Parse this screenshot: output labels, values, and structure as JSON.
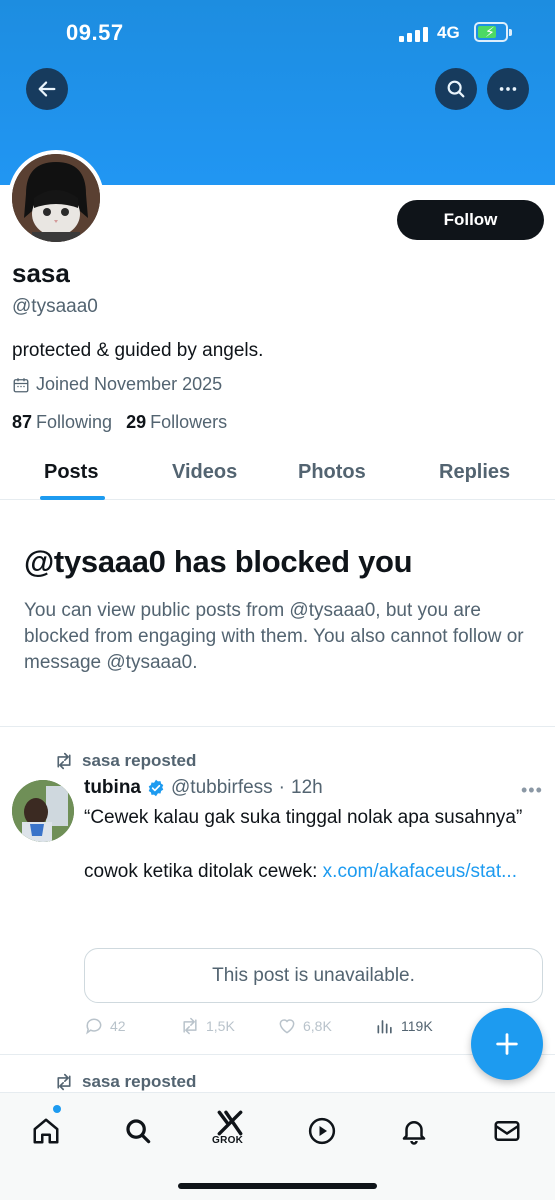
{
  "status_bar": {
    "time": "09.57",
    "network": "4G"
  },
  "header": {
    "back_icon": "arrow-left-icon",
    "search_icon": "search-icon",
    "more_icon": "more-horizontal-icon"
  },
  "profile": {
    "display_name": "sasa",
    "handle": "@tysaaa0",
    "follow_label": "Follow",
    "bio": "protected & guided by angels.",
    "joined": "Joined November 2025",
    "following_count": "87",
    "following_label": "Following",
    "followers_count": "29",
    "followers_label": "Followers"
  },
  "tabs": [
    {
      "label": "Posts",
      "active": true
    },
    {
      "label": "Videos",
      "active": false
    },
    {
      "label": "Photos",
      "active": false
    },
    {
      "label": "Replies",
      "active": false
    }
  ],
  "blocked": {
    "title": "@tysaaa0 has blocked you",
    "body": "You can view public posts from @tysaaa0, but you are blocked from engaging with them. You also cannot follow or message @tysaaa0."
  },
  "post": {
    "repost_label": "sasa reposted",
    "author_name": "tubina",
    "author_handle": "@tubbirfess",
    "separator": "·",
    "time": "12h",
    "text": "“Cewek kalau gak suka tinggal nolak apa susahnya”\n\ncowok ketika ditolak cewek: ",
    "link": "x.com/akafaceus/stat...",
    "quote_unavailable": "This post is unavailable.",
    "replies": "42",
    "reposts": "1,5K",
    "likes": "6,8K",
    "views": "119K"
  },
  "next_repost_label": "sasa reposted",
  "bottom_nav": {
    "grok_label": "GROK"
  },
  "colors": {
    "accent": "#1d9bf0",
    "banner": "#2196f3",
    "text": "#0f1419",
    "muted": "#536471"
  }
}
